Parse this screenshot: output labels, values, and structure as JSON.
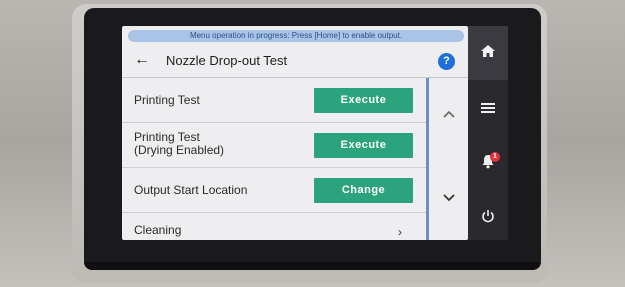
{
  "banner": {
    "text": "Menu operation in progress: Press [Home] to enable output."
  },
  "header": {
    "back_icon": "back-arrow-icon",
    "title": "Nozzle Drop-out Test",
    "help_icon": "help-icon"
  },
  "rows": [
    {
      "label": "Printing Test",
      "action": "Execute"
    },
    {
      "label_line1": "Printing Test",
      "label_line2": "(Drying Enabled)",
      "action": "Execute"
    },
    {
      "label": "Output Start Location",
      "action": "Change"
    },
    {
      "label": "Cleaning",
      "action_icon": "chevron-right-icon"
    }
  ],
  "sidebar": {
    "items": [
      {
        "icon": "home-icon"
      },
      {
        "icon": "menu-icon"
      },
      {
        "icon": "bell-icon",
        "badge": "1"
      },
      {
        "icon": "power-icon"
      }
    ]
  },
  "colors": {
    "action_button": "#2ba47d",
    "banner": "#a9c4e6",
    "help": "#1e6fd9",
    "badge": "#e0323b"
  }
}
